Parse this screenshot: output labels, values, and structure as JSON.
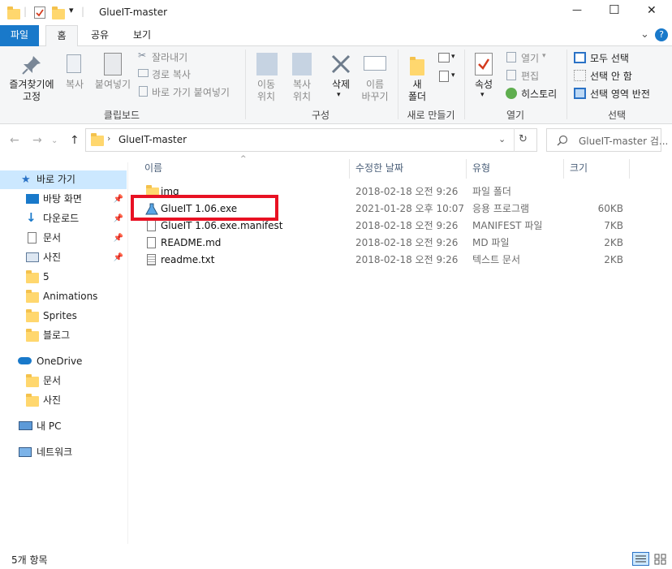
{
  "window": {
    "title": "GlueIT-master",
    "quick_access_divider": "|",
    "minimize": "—",
    "maximize": "☐",
    "close": "✕",
    "chevron": "⌄",
    "help": "?"
  },
  "ribbon_tabs": [
    "파일",
    "홈",
    "공유",
    "보기"
  ],
  "ribbon": {
    "clipboard": {
      "pin": "즐겨찾기에\n고정",
      "copy": "복사",
      "paste": "붙여넣기",
      "cut": "잘라내기",
      "copy_path": "경로 복사",
      "paste_shortcut": "바로 가기 붙여넣기",
      "label": "클립보드"
    },
    "organize": {
      "move": "이동\n위치",
      "copy_to": "복사\n위치",
      "delete": "삭제",
      "rename": "이름\n바꾸기",
      "label": "구성"
    },
    "new": {
      "new_folder": "새\n폴더",
      "label": "새로 만들기"
    },
    "open": {
      "properties": "속성",
      "open": "열기",
      "edit": "편집",
      "history": "히스토리",
      "label": "열기"
    },
    "select": {
      "select_all": "모두 선택",
      "select_none": "선택 안 함",
      "invert": "선택 영역 반전",
      "label": "선택"
    }
  },
  "address": {
    "path": "GlueIT-master",
    "search_placeholder": "GlueIT-master 검..."
  },
  "nav": {
    "quick_access": "바로 가기",
    "items": [
      {
        "label": "바탕 화면",
        "pinned": true
      },
      {
        "label": "다운로드",
        "pinned": true
      },
      {
        "label": "문서",
        "pinned": true
      },
      {
        "label": "사진",
        "pinned": true
      },
      {
        "label": "5",
        "pinned": false
      },
      {
        "label": "Animations",
        "pinned": false
      },
      {
        "label": "Sprites",
        "pinned": false
      },
      {
        "label": "블로그",
        "pinned": false
      }
    ],
    "onedrive": "OneDrive",
    "onedrive_items": [
      "문서",
      "사진"
    ],
    "this_pc": "내 PC",
    "network": "네트워크"
  },
  "columns": {
    "name": "이름",
    "date": "수정한 날짜",
    "type": "유형",
    "size": "크기"
  },
  "files": [
    {
      "name": "img",
      "date": "2018-02-18 오전 9:26",
      "type": "파일 폴더",
      "size": "",
      "icon": "folder-icon"
    },
    {
      "name": "GlueIT 1.06.exe",
      "date": "2021-01-28 오후 10:07",
      "type": "응용 프로그램",
      "size": "60KB",
      "icon": "exe-icon"
    },
    {
      "name": "GlueIT 1.06.exe.manifest",
      "date": "2018-02-18 오전 9:26",
      "type": "MANIFEST 파일",
      "size": "7KB",
      "icon": "file-icon"
    },
    {
      "name": "README.md",
      "date": "2018-02-18 오전 9:26",
      "type": "MD 파일",
      "size": "2KB",
      "icon": "file-icon"
    },
    {
      "name": "readme.txt",
      "date": "2018-02-18 오전 9:26",
      "type": "텍스트 문서",
      "size": "2KB",
      "icon": "text-file-icon"
    }
  ],
  "status": {
    "count": "5개 항목"
  },
  "colors": {
    "accent": "#1979ca",
    "selection": "#cce8ff",
    "highlight_box": "#e81123"
  }
}
